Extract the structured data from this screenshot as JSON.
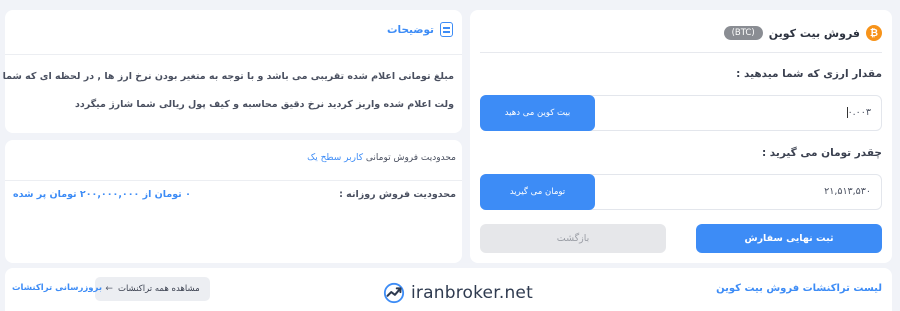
{
  "sell": {
    "coin_symbol": "₿",
    "title": "فروش بیت کوین",
    "badge": "(BTC)",
    "amount_label": "مقدار ارزی که شما میدهید :",
    "amount_value": "۰.۰۰۳",
    "amount_button": "بیت کوین می دهید",
    "toman_label": "چقدر تومان می گیرید :",
    "toman_value": "۲۱,۵۱۳,۵۳۰",
    "toman_button": "تومان می گیرید",
    "submit_button": "ثبت نهایی سفارش",
    "back_button": "بازگشت"
  },
  "description": {
    "title": "توضیحات",
    "line1": "مبلغ تومانی اعلام شده تقریبی می باشد و با توجه به متغیر بودن نرخ ارز ها , در لحظه ای که شما ارز را به",
    "line2": "ولت اعلام شده واریز کردید نرخ دقیق محاسبه و کیف پول ریالی شما شارژ میگردد"
  },
  "limits": {
    "row1_key": "محدودیت فروش تومانی",
    "row1_user": "کاربر سطح یک",
    "row2_key": "محدودیت فروش روزانه :",
    "row2_value": "۰ تومان از ۲۰۰,۰۰۰,۰۰۰ تومان پر شده"
  },
  "transactions": {
    "title": "لیست تراکنشات فروش بیت کوین",
    "view_all": "مشاهده همه تراکنشات",
    "refresh": "بروزرسانی تراکنشات"
  },
  "watermark": {
    "text": "iranbroker.net"
  },
  "colors": {
    "accent": "#3d8cf6",
    "btc": "#f7931a",
    "background": "#f1f3f8"
  }
}
